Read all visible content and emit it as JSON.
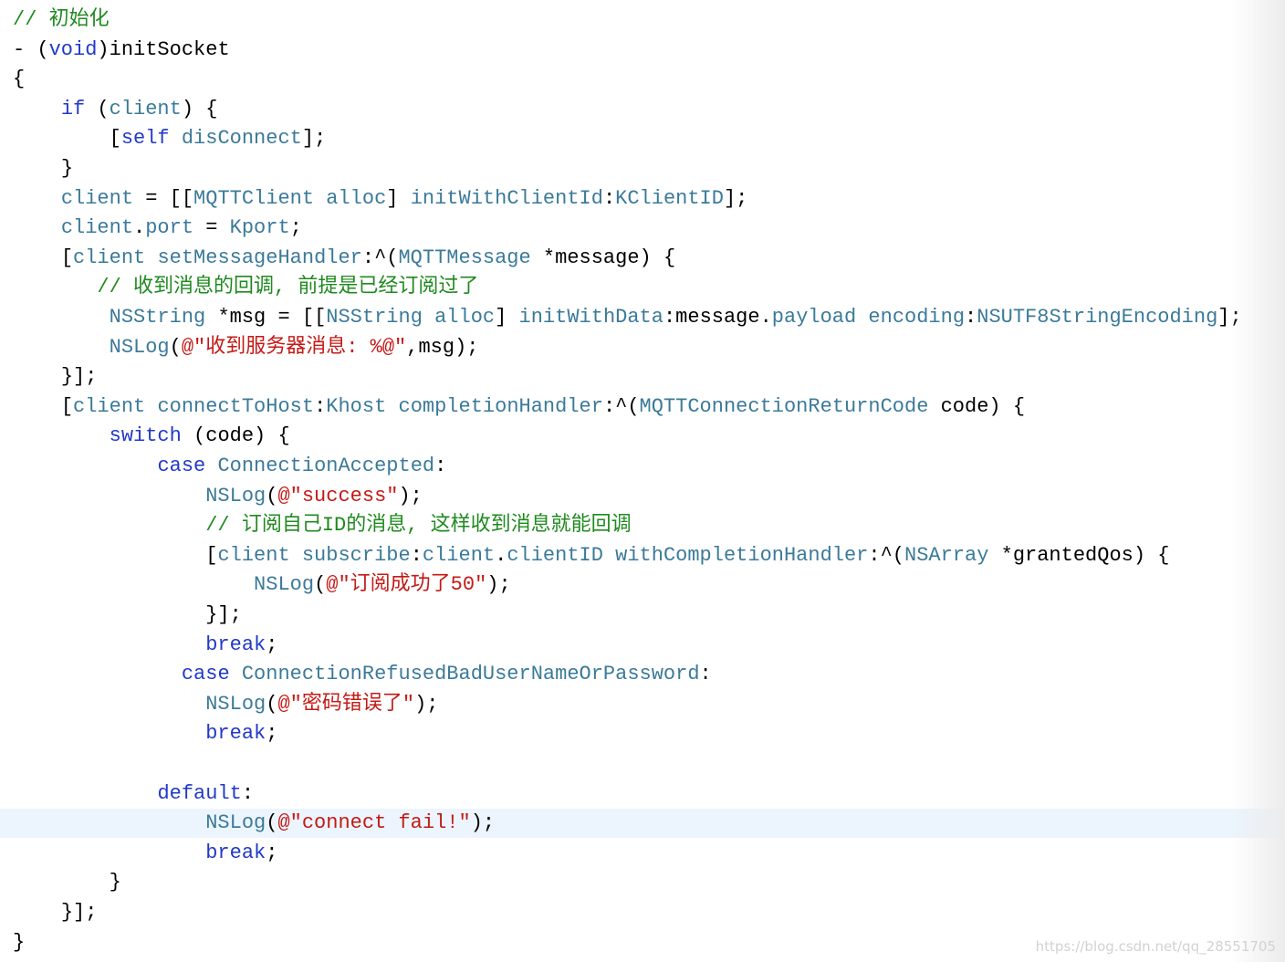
{
  "colors": {
    "plain": "#000000",
    "keyword": "#2239c9",
    "project": "#3b7a9a",
    "comment": "#1f8a1f",
    "string": "#c41a16",
    "highlight_line": "#ecf5fd"
  },
  "code_lines": [
    {
      "indent": "",
      "tokens": [
        {
          "t": "// 初始化",
          "k": "comment"
        }
      ]
    },
    {
      "indent": "",
      "tokens": [
        {
          "t": "- (",
          "k": "plain"
        },
        {
          "t": "void",
          "k": "keyword"
        },
        {
          "t": ")initSocket",
          "k": "plain"
        }
      ]
    },
    {
      "indent": "",
      "tokens": [
        {
          "t": "{",
          "k": "plain"
        }
      ]
    },
    {
      "indent": "    ",
      "tokens": [
        {
          "t": "if",
          "k": "keyword"
        },
        {
          "t": " (",
          "k": "plain"
        },
        {
          "t": "client",
          "k": "project"
        },
        {
          "t": ") {",
          "k": "plain"
        }
      ]
    },
    {
      "indent": "        ",
      "tokens": [
        {
          "t": "[",
          "k": "plain"
        },
        {
          "t": "self",
          "k": "keyword"
        },
        {
          "t": " ",
          "k": "plain"
        },
        {
          "t": "disConnect",
          "k": "project"
        },
        {
          "t": "];",
          "k": "plain"
        }
      ]
    },
    {
      "indent": "    ",
      "tokens": [
        {
          "t": "}",
          "k": "plain"
        }
      ]
    },
    {
      "indent": "    ",
      "tokens": [
        {
          "t": "client",
          "k": "project"
        },
        {
          "t": " = [[",
          "k": "plain"
        },
        {
          "t": "MQTTClient",
          "k": "project"
        },
        {
          "t": " ",
          "k": "plain"
        },
        {
          "t": "alloc",
          "k": "project"
        },
        {
          "t": "] ",
          "k": "plain"
        },
        {
          "t": "initWithClientId",
          "k": "project"
        },
        {
          "t": ":",
          "k": "plain"
        },
        {
          "t": "KClientID",
          "k": "project"
        },
        {
          "t": "];",
          "k": "plain"
        }
      ]
    },
    {
      "indent": "    ",
      "tokens": [
        {
          "t": "client",
          "k": "project"
        },
        {
          "t": ".",
          "k": "plain"
        },
        {
          "t": "port",
          "k": "project"
        },
        {
          "t": " = ",
          "k": "plain"
        },
        {
          "t": "Kport",
          "k": "project"
        },
        {
          "t": ";",
          "k": "plain"
        }
      ]
    },
    {
      "indent": "    ",
      "tokens": [
        {
          "t": "[",
          "k": "plain"
        },
        {
          "t": "client",
          "k": "project"
        },
        {
          "t": " ",
          "k": "plain"
        },
        {
          "t": "setMessageHandler",
          "k": "project"
        },
        {
          "t": ":^(",
          "k": "plain"
        },
        {
          "t": "MQTTMessage",
          "k": "project"
        },
        {
          "t": " *message) {",
          "k": "plain"
        }
      ]
    },
    {
      "indent": "       ",
      "tokens": [
        {
          "t": "// 收到消息的回调, 前提是已经订阅过了",
          "k": "comment"
        }
      ]
    },
    {
      "indent": "        ",
      "tokens": [
        {
          "t": "NSString",
          "k": "project"
        },
        {
          "t": " *msg = [[",
          "k": "plain"
        },
        {
          "t": "NSString",
          "k": "project"
        },
        {
          "t": " ",
          "k": "plain"
        },
        {
          "t": "alloc",
          "k": "project"
        },
        {
          "t": "] ",
          "k": "plain"
        },
        {
          "t": "initWithData",
          "k": "project"
        },
        {
          "t": ":message.",
          "k": "plain"
        },
        {
          "t": "payload",
          "k": "project"
        },
        {
          "t": " ",
          "k": "plain"
        },
        {
          "t": "encoding",
          "k": "project"
        },
        {
          "t": ":",
          "k": "plain"
        },
        {
          "t": "NSUTF8StringEncoding",
          "k": "project"
        },
        {
          "t": "];",
          "k": "plain"
        }
      ]
    },
    {
      "indent": "        ",
      "tokens": [
        {
          "t": "NSLog",
          "k": "project"
        },
        {
          "t": "(",
          "k": "plain"
        },
        {
          "t": "@\"收到服务器消息: %@\"",
          "k": "string"
        },
        {
          "t": ",msg);",
          "k": "plain"
        }
      ]
    },
    {
      "indent": "    ",
      "tokens": [
        {
          "t": "}];",
          "k": "plain"
        }
      ]
    },
    {
      "indent": "    ",
      "tokens": [
        {
          "t": "[",
          "k": "plain"
        },
        {
          "t": "client",
          "k": "project"
        },
        {
          "t": " ",
          "k": "plain"
        },
        {
          "t": "connectToHost",
          "k": "project"
        },
        {
          "t": ":",
          "k": "plain"
        },
        {
          "t": "Khost",
          "k": "project"
        },
        {
          "t": " ",
          "k": "plain"
        },
        {
          "t": "completionHandler",
          "k": "project"
        },
        {
          "t": ":^(",
          "k": "plain"
        },
        {
          "t": "MQTTConnectionReturnCode",
          "k": "project"
        },
        {
          "t": " code) {",
          "k": "plain"
        }
      ]
    },
    {
      "indent": "        ",
      "tokens": [
        {
          "t": "switch",
          "k": "keyword"
        },
        {
          "t": " (code) {",
          "k": "plain"
        }
      ]
    },
    {
      "indent": "            ",
      "tokens": [
        {
          "t": "case",
          "k": "keyword"
        },
        {
          "t": " ",
          "k": "plain"
        },
        {
          "t": "ConnectionAccepted",
          "k": "project"
        },
        {
          "t": ":",
          "k": "plain"
        }
      ]
    },
    {
      "indent": "                ",
      "tokens": [
        {
          "t": "NSLog",
          "k": "project"
        },
        {
          "t": "(",
          "k": "plain"
        },
        {
          "t": "@\"success\"",
          "k": "string"
        },
        {
          "t": ");",
          "k": "plain"
        }
      ]
    },
    {
      "indent": "                ",
      "tokens": [
        {
          "t": "// 订阅自己ID的消息, 这样收到消息就能回调",
          "k": "comment"
        }
      ]
    },
    {
      "indent": "                ",
      "tokens": [
        {
          "t": "[",
          "k": "plain"
        },
        {
          "t": "client",
          "k": "project"
        },
        {
          "t": " ",
          "k": "plain"
        },
        {
          "t": "subscribe",
          "k": "project"
        },
        {
          "t": ":",
          "k": "plain"
        },
        {
          "t": "client",
          "k": "project"
        },
        {
          "t": ".",
          "k": "plain"
        },
        {
          "t": "clientID",
          "k": "project"
        },
        {
          "t": " ",
          "k": "plain"
        },
        {
          "t": "withCompletionHandler",
          "k": "project"
        },
        {
          "t": ":^(",
          "k": "plain"
        },
        {
          "t": "NSArray",
          "k": "project"
        },
        {
          "t": " *grantedQos) {",
          "k": "plain"
        }
      ]
    },
    {
      "indent": "                    ",
      "tokens": [
        {
          "t": "NSLog",
          "k": "project"
        },
        {
          "t": "(",
          "k": "plain"
        },
        {
          "t": "@\"订阅成功了50\"",
          "k": "string"
        },
        {
          "t": ");",
          "k": "plain"
        }
      ]
    },
    {
      "indent": "                ",
      "tokens": [
        {
          "t": "}];",
          "k": "plain"
        }
      ]
    },
    {
      "indent": "                ",
      "tokens": [
        {
          "t": "break",
          "k": "keyword"
        },
        {
          "t": ";",
          "k": "plain"
        }
      ]
    },
    {
      "indent": "              ",
      "tokens": [
        {
          "t": "case",
          "k": "keyword"
        },
        {
          "t": " ",
          "k": "plain"
        },
        {
          "t": "ConnectionRefusedBadUserNameOrPassword",
          "k": "project"
        },
        {
          "t": ":",
          "k": "plain"
        }
      ]
    },
    {
      "indent": "                ",
      "tokens": [
        {
          "t": "NSLog",
          "k": "project"
        },
        {
          "t": "(",
          "k": "plain"
        },
        {
          "t": "@\"密码错误了\"",
          "k": "string"
        },
        {
          "t": ");",
          "k": "plain"
        }
      ]
    },
    {
      "indent": "                ",
      "tokens": [
        {
          "t": "break",
          "k": "keyword"
        },
        {
          "t": ";",
          "k": "plain"
        }
      ]
    },
    {
      "indent": "",
      "tokens": []
    },
    {
      "indent": "            ",
      "tokens": [
        {
          "t": "default",
          "k": "keyword"
        },
        {
          "t": ":",
          "k": "plain"
        }
      ]
    },
    {
      "indent": "                ",
      "highlight": true,
      "tokens": [
        {
          "t": "NSLog",
          "k": "project"
        },
        {
          "t": "(",
          "k": "plain"
        },
        {
          "t": "@\"connect fail!\"",
          "k": "string"
        },
        {
          "t": ");",
          "k": "plain"
        }
      ]
    },
    {
      "indent": "                ",
      "tokens": [
        {
          "t": "break",
          "k": "keyword"
        },
        {
          "t": ";",
          "k": "plain"
        }
      ]
    },
    {
      "indent": "        ",
      "tokens": [
        {
          "t": "}",
          "k": "plain"
        }
      ]
    },
    {
      "indent": "    ",
      "tokens": [
        {
          "t": "}];",
          "k": "plain"
        }
      ]
    },
    {
      "indent": "",
      "tokens": [
        {
          "t": "}",
          "k": "plain"
        }
      ]
    }
  ],
  "watermark": "https://blog.csdn.net/qq_28551705"
}
